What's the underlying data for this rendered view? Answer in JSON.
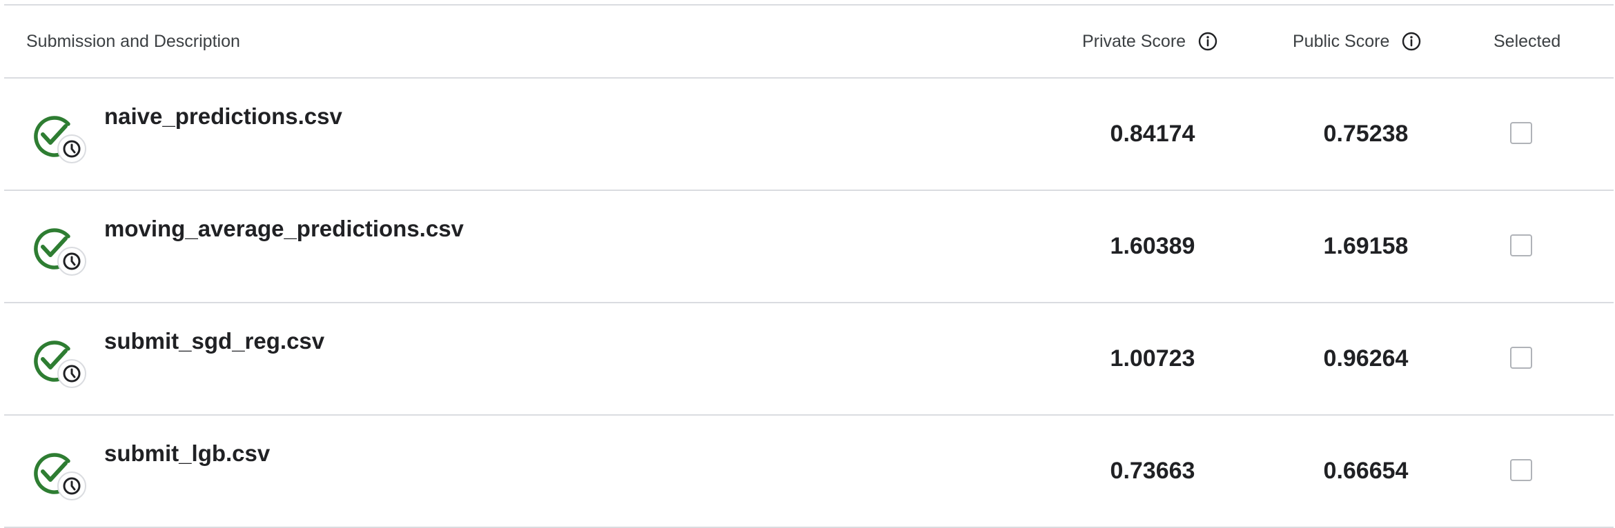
{
  "table": {
    "columns": {
      "submission": "Submission and Description",
      "private_score": "Private Score",
      "public_score": "Public Score",
      "selected": "Selected"
    },
    "rows": [
      {
        "filename": "naive_predictions.csv",
        "private_score": "0.84174",
        "public_score": "0.75238",
        "selected": false,
        "status_icon": "complete-check-clock-icon"
      },
      {
        "filename": "moving_average_predictions.csv",
        "private_score": "1.60389",
        "public_score": "1.69158",
        "selected": false,
        "status_icon": "complete-check-clock-icon"
      },
      {
        "filename": "submit_sgd_reg.csv",
        "private_score": "1.00723",
        "public_score": "0.96264",
        "selected": false,
        "status_icon": "complete-check-clock-icon"
      },
      {
        "filename": "submit_lgb.csv",
        "private_score": "0.73663",
        "public_score": "0.66654",
        "selected": false,
        "status_icon": "complete-check-clock-icon"
      }
    ]
  },
  "colors": {
    "success_green": "#2e7d32",
    "divider": "#dadce0",
    "text": "#202124"
  }
}
